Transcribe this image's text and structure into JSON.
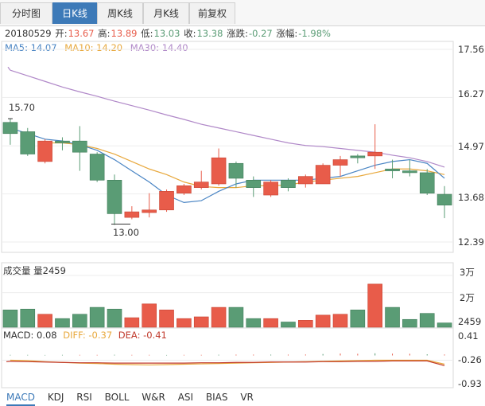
{
  "tabs": [
    {
      "label": "分时图",
      "active": false
    },
    {
      "label": "日K线",
      "active": true
    },
    {
      "label": "周K线",
      "active": false
    },
    {
      "label": "月K线",
      "active": false
    },
    {
      "label": "前复权",
      "active": false
    }
  ],
  "info": {
    "date": "20180529",
    "open_label": "开:",
    "open": "13.67",
    "high_label": "高:",
    "high": "13.89",
    "low_label": "低:",
    "low": "13.03",
    "close_label": "收:",
    "close": "13.38",
    "change_label": "涨跌:",
    "change": "-0.27",
    "pct_label": "涨幅:",
    "pct": "-1.98%"
  },
  "ma": {
    "ma5": "MA5: 14.07",
    "ma10": "MA10: 14.20",
    "ma30": "MA30: 14.40"
  },
  "volume_header": {
    "title": "成交量",
    "value": "量2459"
  },
  "macd_header": {
    "macd": "MACD: 0.08",
    "diff": "DIFF: -0.37",
    "dea": "DEA: -0.41"
  },
  "bottom_tabs": [
    "MACD",
    "KDJ",
    "RSI",
    "BOLL",
    "W&R",
    "ASI",
    "BIAS",
    "VR"
  ],
  "colors": {
    "up": "#e85c4a",
    "down": "#5a9c75",
    "ma5": "#4a85c4",
    "ma10": "#e8a83c",
    "ma30": "#b088c8",
    "tab_active": "#3d7ab8"
  },
  "chart_data": [
    {
      "type": "candlestick",
      "title": "日K线",
      "y_ticks": [
        "17.56",
        "16.27",
        "14.97",
        "13.68",
        "12.39"
      ],
      "ylim": [
        12.39,
        17.56
      ],
      "annotations": {
        "max": "15.70",
        "min": "13.00"
      },
      "candles": [
        {
          "open": 15.6,
          "close": 15.3,
          "high": 15.7,
          "low": 15.0
        },
        {
          "open": 15.35,
          "close": 14.75,
          "high": 15.45,
          "low": 14.7
        },
        {
          "open": 14.55,
          "close": 15.1,
          "high": 15.15,
          "low": 14.5
        },
        {
          "open": 15.1,
          "close": 15.05,
          "high": 15.2,
          "low": 14.85
        },
        {
          "open": 15.1,
          "close": 14.8,
          "high": 15.5,
          "low": 14.3
        },
        {
          "open": 14.75,
          "close": 14.05,
          "high": 14.8,
          "low": 14.0
        },
        {
          "open": 14.05,
          "close": 13.15,
          "high": 14.2,
          "low": 12.85
        },
        {
          "open": 13.05,
          "close": 13.2,
          "high": 13.35,
          "low": 13.0
        },
        {
          "open": 13.18,
          "close": 13.25,
          "high": 13.7,
          "low": 13.05
        },
        {
          "open": 13.25,
          "close": 13.75,
          "high": 13.8,
          "low": 13.2
        },
        {
          "open": 13.7,
          "close": 13.9,
          "high": 13.95,
          "low": 13.65
        },
        {
          "open": 13.85,
          "close": 14.0,
          "high": 14.3,
          "low": 13.8
        },
        {
          "open": 13.95,
          "close": 14.65,
          "high": 14.9,
          "low": 13.9
        },
        {
          "open": 14.5,
          "close": 14.1,
          "high": 14.55,
          "low": 13.85
        },
        {
          "open": 14.05,
          "close": 13.85,
          "high": 14.15,
          "low": 13.6
        },
        {
          "open": 13.65,
          "close": 14.0,
          "high": 14.05,
          "low": 13.6
        },
        {
          "open": 14.05,
          "close": 13.85,
          "high": 14.1,
          "low": 13.75
        },
        {
          "open": 13.95,
          "close": 14.15,
          "high": 14.2,
          "low": 13.85
        },
        {
          "open": 13.95,
          "close": 14.45,
          "high": 14.5,
          "low": 13.95
        },
        {
          "open": 14.45,
          "close": 14.6,
          "high": 14.7,
          "low": 14.15
        },
        {
          "open": 14.7,
          "close": 14.65,
          "high": 14.75,
          "low": 14.5
        },
        {
          "open": 14.7,
          "close": 14.8,
          "high": 15.55,
          "low": 14.35
        },
        {
          "open": 14.35,
          "close": 14.3,
          "high": 14.6,
          "low": 14.1
        },
        {
          "open": 14.3,
          "close": 14.25,
          "high": 14.6,
          "low": 14.15
        },
        {
          "open": 14.25,
          "close": 13.7,
          "high": 14.35,
          "low": 13.65
        },
        {
          "open": 13.67,
          "close": 13.38,
          "high": 13.89,
          "low": 13.03
        }
      ],
      "ma5": [
        15.45,
        15.3,
        15.15,
        15.1,
        15.0,
        14.85,
        14.6,
        14.3,
        14.0,
        13.65,
        13.45,
        13.5,
        13.75,
        13.95,
        14.05,
        14.05,
        14.05,
        14.05,
        14.1,
        14.15,
        14.3,
        14.45,
        14.55,
        14.6,
        14.5,
        14.1
      ],
      "ma10": [
        null,
        null,
        15.05,
        15.05,
        15.0,
        14.9,
        14.75,
        14.55,
        14.35,
        14.2,
        14.0,
        13.88,
        13.85,
        13.85,
        13.9,
        13.9,
        13.92,
        14.0,
        14.05,
        14.1,
        14.15,
        14.25,
        14.35,
        14.35,
        14.3,
        14.2
      ],
      "ma30": [
        17.0,
        16.85,
        16.7,
        16.55,
        16.42,
        16.3,
        16.17,
        16.05,
        15.93,
        15.8,
        15.68,
        15.55,
        15.45,
        15.35,
        15.25,
        15.15,
        15.05,
        14.98,
        14.95,
        14.9,
        14.85,
        14.8,
        14.72,
        14.65,
        14.55,
        14.4
      ]
    },
    {
      "type": "bar",
      "title": "成交量",
      "y_ticks": [
        "3万",
        "2万",
        "2459"
      ],
      "ylim": [
        0,
        30000
      ],
      "values": [
        10000,
        10500,
        7500,
        5000,
        7500,
        11500,
        10500,
        5500,
        13500,
        10000,
        5000,
        6000,
        11500,
        11500,
        5000,
        5000,
        3000,
        4000,
        7000,
        7500,
        10000,
        25000,
        11500,
        4500,
        8000,
        2459
      ]
    },
    {
      "type": "line",
      "title": "MACD",
      "y_ticks": [
        "0.41",
        "-0.26",
        "-0.93"
      ],
      "ylim": [
        -0.93,
        0.41
      ],
      "macd_bars": [
        -0.05,
        -0.05,
        -0.04,
        -0.05,
        -0.05,
        -0.05,
        -0.06,
        -0.05,
        -0.05,
        -0.04,
        -0.05,
        -0.05,
        -0.06,
        -0.07,
        -0.07,
        -0.07,
        -0.07,
        -0.08,
        -0.12,
        -0.16,
        -0.14,
        -0.18,
        -0.15,
        -0.14,
        -0.1,
        0.08
      ],
      "diff": [
        -0.26,
        -0.27,
        -0.3,
        -0.32,
        -0.34,
        -0.35,
        -0.37,
        -0.38,
        -0.39,
        -0.38,
        -0.37,
        -0.36,
        -0.35,
        -0.34,
        -0.33,
        -0.32,
        -0.31,
        -0.3,
        -0.29,
        -0.28,
        -0.27,
        -0.26,
        -0.26,
        -0.26,
        -0.26,
        -0.37
      ],
      "dea": [
        -0.29,
        -0.3,
        -0.31,
        -0.32,
        -0.33,
        -0.33,
        -0.34,
        -0.34,
        -0.34,
        -0.34,
        -0.34,
        -0.33,
        -0.33,
        -0.32,
        -0.32,
        -0.31,
        -0.31,
        -0.31,
        -0.3,
        -0.3,
        -0.29,
        -0.29,
        -0.28,
        -0.28,
        -0.28,
        -0.41
      ]
    }
  ]
}
